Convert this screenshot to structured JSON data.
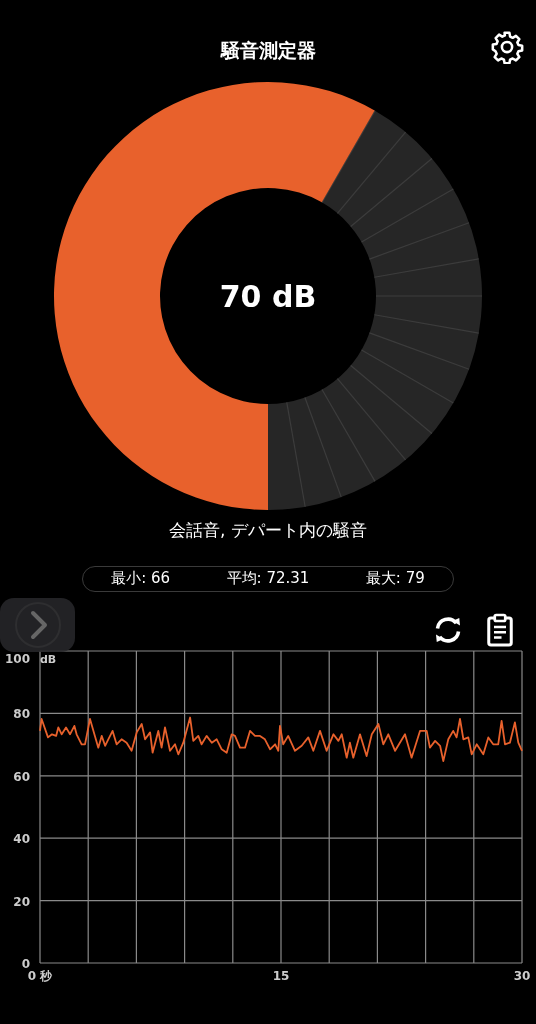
{
  "header": {
    "title": "騒音測定器"
  },
  "gauge": {
    "reading": "70 dB"
  },
  "description": "会話音, デパート内の騒音",
  "stats": [
    {
      "label": "最小: 66"
    },
    {
      "label": "平均: 72.31"
    },
    {
      "label": "最大: 79"
    }
  ],
  "chart": {
    "chart_data": {
      "type": "line",
      "ylabel": "dB",
      "xlim": [
        0,
        30
      ],
      "ylim": [
        0,
        100
      ],
      "grid": true,
      "xticks": [
        {
          "value": 0,
          "label": "0 秒"
        },
        15,
        30
      ],
      "yticks": [
        0,
        20,
        40,
        60,
        80,
        100
      ],
      "x": [
        0,
        0.1,
        0.5,
        0.75,
        1.0,
        1.14,
        1.35,
        1.62,
        1.87,
        2.14,
        2.28,
        2.59,
        2.8,
        3.11,
        3.42,
        3.63,
        3.84,
        4.05,
        4.25,
        4.52,
        4.77,
        5.08,
        5.39,
        5.7,
        6.02,
        6.33,
        6.54,
        6.85,
        7.01,
        7.36,
        7.57,
        7.78,
        8.09,
        8.4,
        8.61,
        8.92,
        9.34,
        9.54,
        9.85,
        10.06,
        10.37,
        10.69,
        11.0,
        11.31,
        11.62,
        11.93,
        12.14,
        12.45,
        12.76,
        13.07,
        13.38,
        13.69,
        14.0,
        14.32,
        14.63,
        14.83,
        14.94,
        15.14,
        15.45,
        15.87,
        16.29,
        16.7,
        17.01,
        17.43,
        17.84,
        18.26,
        18.57,
        18.78,
        19.09,
        19.29,
        19.5,
        19.92,
        20.33,
        20.65,
        21.06,
        21.37,
        21.68,
        22.1,
        22.72,
        23.13,
        23.65,
        24.07,
        24.27,
        24.59,
        24.9,
        25.1,
        25.41,
        25.72,
        25.93,
        26.14,
        26.35,
        26.66,
        26.87,
        27.18,
        27.59,
        27.9,
        28.21,
        28.52,
        28.73,
        28.94,
        29.25,
        29.56,
        29.77,
        30
      ],
      "series": [
        {
          "color": "#e8612c",
          "values": [
            74.4,
            78.2,
            72.3,
            73.3,
            72.8,
            75.5,
            73.3,
            75.5,
            73.3,
            76.0,
            73.3,
            70.1,
            70.1,
            78.2,
            72.8,
            69.0,
            72.8,
            69.6,
            71.7,
            74.4,
            70.1,
            71.7,
            70.6,
            68.0,
            73.9,
            76.6,
            71.7,
            73.9,
            67.4,
            74.4,
            69.0,
            75.5,
            68.0,
            70.1,
            66.9,
            70.6,
            78.7,
            71.2,
            72.8,
            70.1,
            72.8,
            70.6,
            71.7,
            68.5,
            67.4,
            73.3,
            72.8,
            69.0,
            69.0,
            74.4,
            72.8,
            72.8,
            71.7,
            68.5,
            70.1,
            68.0,
            76.0,
            70.1,
            72.8,
            68.0,
            69.6,
            72.3,
            68.0,
            74.4,
            68.0,
            73.3,
            71.2,
            73.3,
            65.8,
            70.6,
            65.8,
            73.3,
            66.3,
            73.3,
            76.6,
            70.1,
            73.3,
            68.0,
            73.3,
            65.8,
            74.4,
            74.4,
            69.0,
            71.2,
            69.6,
            64.7,
            71.7,
            74.4,
            72.3,
            78.2,
            71.7,
            72.3,
            66.9,
            70.1,
            66.9,
            72.3,
            70.1,
            70.1,
            77.6,
            70.1,
            70.6,
            77.1,
            70.6,
            68.0
          ]
        }
      ]
    }
  }
}
